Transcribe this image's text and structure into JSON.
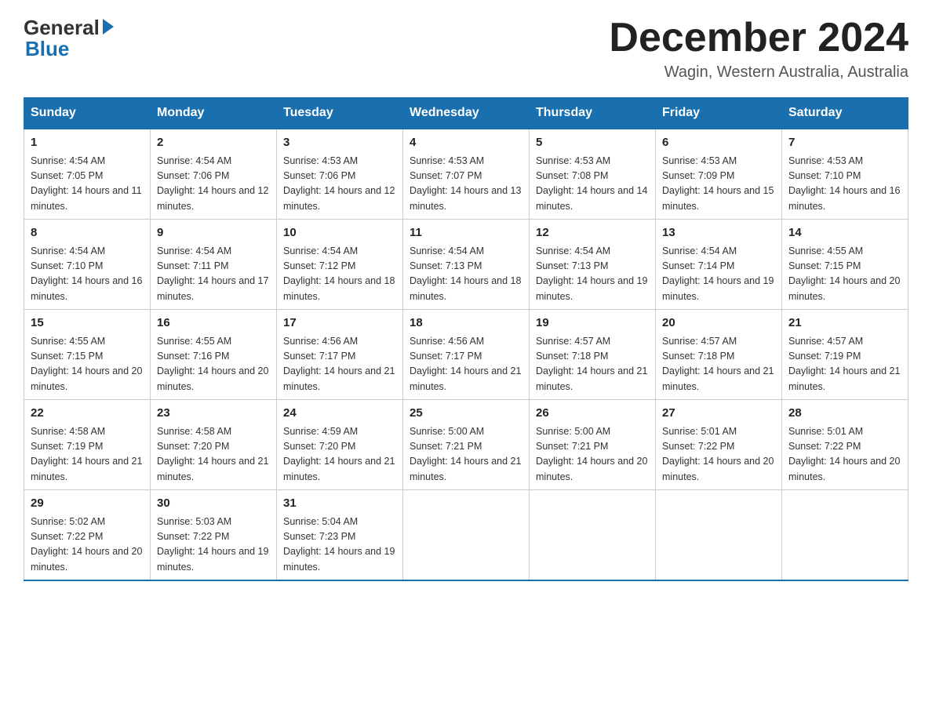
{
  "header": {
    "logo_general": "General",
    "logo_blue": "Blue",
    "month_title": "December 2024",
    "location": "Wagin, Western Australia, Australia"
  },
  "days_of_week": [
    "Sunday",
    "Monday",
    "Tuesday",
    "Wednesday",
    "Thursday",
    "Friday",
    "Saturday"
  ],
  "weeks": [
    [
      {
        "day": "1",
        "sunrise": "4:54 AM",
        "sunset": "7:05 PM",
        "daylight": "14 hours and 11 minutes."
      },
      {
        "day": "2",
        "sunrise": "4:54 AM",
        "sunset": "7:06 PM",
        "daylight": "14 hours and 12 minutes."
      },
      {
        "day": "3",
        "sunrise": "4:53 AM",
        "sunset": "7:06 PM",
        "daylight": "14 hours and 12 minutes."
      },
      {
        "day": "4",
        "sunrise": "4:53 AM",
        "sunset": "7:07 PM",
        "daylight": "14 hours and 13 minutes."
      },
      {
        "day": "5",
        "sunrise": "4:53 AM",
        "sunset": "7:08 PM",
        "daylight": "14 hours and 14 minutes."
      },
      {
        "day": "6",
        "sunrise": "4:53 AM",
        "sunset": "7:09 PM",
        "daylight": "14 hours and 15 minutes."
      },
      {
        "day": "7",
        "sunrise": "4:53 AM",
        "sunset": "7:10 PM",
        "daylight": "14 hours and 16 minutes."
      }
    ],
    [
      {
        "day": "8",
        "sunrise": "4:54 AM",
        "sunset": "7:10 PM",
        "daylight": "14 hours and 16 minutes."
      },
      {
        "day": "9",
        "sunrise": "4:54 AM",
        "sunset": "7:11 PM",
        "daylight": "14 hours and 17 minutes."
      },
      {
        "day": "10",
        "sunrise": "4:54 AM",
        "sunset": "7:12 PM",
        "daylight": "14 hours and 18 minutes."
      },
      {
        "day": "11",
        "sunrise": "4:54 AM",
        "sunset": "7:13 PM",
        "daylight": "14 hours and 18 minutes."
      },
      {
        "day": "12",
        "sunrise": "4:54 AM",
        "sunset": "7:13 PM",
        "daylight": "14 hours and 19 minutes."
      },
      {
        "day": "13",
        "sunrise": "4:54 AM",
        "sunset": "7:14 PM",
        "daylight": "14 hours and 19 minutes."
      },
      {
        "day": "14",
        "sunrise": "4:55 AM",
        "sunset": "7:15 PM",
        "daylight": "14 hours and 20 minutes."
      }
    ],
    [
      {
        "day": "15",
        "sunrise": "4:55 AM",
        "sunset": "7:15 PM",
        "daylight": "14 hours and 20 minutes."
      },
      {
        "day": "16",
        "sunrise": "4:55 AM",
        "sunset": "7:16 PM",
        "daylight": "14 hours and 20 minutes."
      },
      {
        "day": "17",
        "sunrise": "4:56 AM",
        "sunset": "7:17 PM",
        "daylight": "14 hours and 21 minutes."
      },
      {
        "day": "18",
        "sunrise": "4:56 AM",
        "sunset": "7:17 PM",
        "daylight": "14 hours and 21 minutes."
      },
      {
        "day": "19",
        "sunrise": "4:57 AM",
        "sunset": "7:18 PM",
        "daylight": "14 hours and 21 minutes."
      },
      {
        "day": "20",
        "sunrise": "4:57 AM",
        "sunset": "7:18 PM",
        "daylight": "14 hours and 21 minutes."
      },
      {
        "day": "21",
        "sunrise": "4:57 AM",
        "sunset": "7:19 PM",
        "daylight": "14 hours and 21 minutes."
      }
    ],
    [
      {
        "day": "22",
        "sunrise": "4:58 AM",
        "sunset": "7:19 PM",
        "daylight": "14 hours and 21 minutes."
      },
      {
        "day": "23",
        "sunrise": "4:58 AM",
        "sunset": "7:20 PM",
        "daylight": "14 hours and 21 minutes."
      },
      {
        "day": "24",
        "sunrise": "4:59 AM",
        "sunset": "7:20 PM",
        "daylight": "14 hours and 21 minutes."
      },
      {
        "day": "25",
        "sunrise": "5:00 AM",
        "sunset": "7:21 PM",
        "daylight": "14 hours and 21 minutes."
      },
      {
        "day": "26",
        "sunrise": "5:00 AM",
        "sunset": "7:21 PM",
        "daylight": "14 hours and 20 minutes."
      },
      {
        "day": "27",
        "sunrise": "5:01 AM",
        "sunset": "7:22 PM",
        "daylight": "14 hours and 20 minutes."
      },
      {
        "day": "28",
        "sunrise": "5:01 AM",
        "sunset": "7:22 PM",
        "daylight": "14 hours and 20 minutes."
      }
    ],
    [
      {
        "day": "29",
        "sunrise": "5:02 AM",
        "sunset": "7:22 PM",
        "daylight": "14 hours and 20 minutes."
      },
      {
        "day": "30",
        "sunrise": "5:03 AM",
        "sunset": "7:22 PM",
        "daylight": "14 hours and 19 minutes."
      },
      {
        "day": "31",
        "sunrise": "5:04 AM",
        "sunset": "7:23 PM",
        "daylight": "14 hours and 19 minutes."
      },
      null,
      null,
      null,
      null
    ]
  ]
}
